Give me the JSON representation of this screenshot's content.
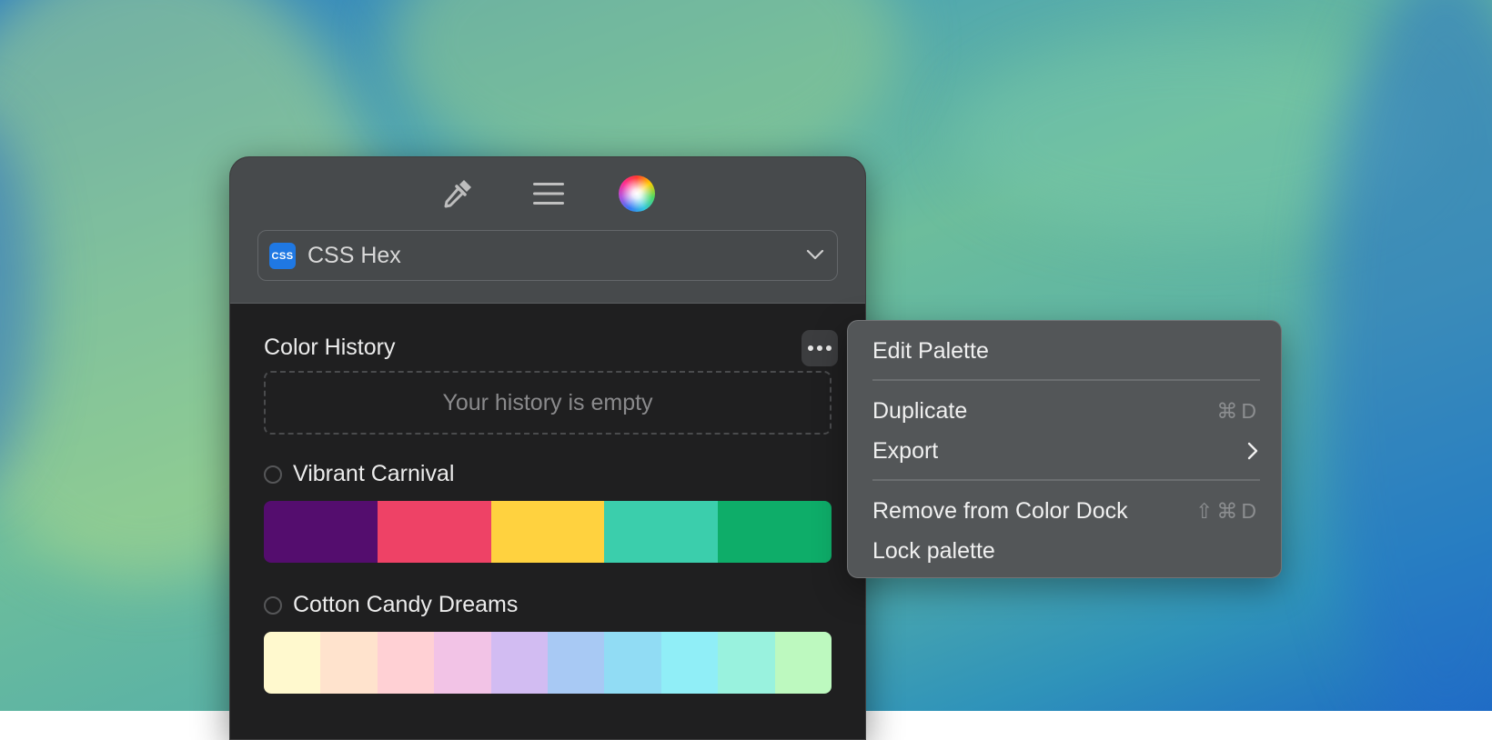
{
  "toolbar": {
    "tools": [
      "eyedropper-icon",
      "menu-icon",
      "color-wheel-icon"
    ]
  },
  "format_selector": {
    "badge": "CSS",
    "value": "CSS Hex"
  },
  "color_history": {
    "title": "Color History",
    "empty_text": "Your history is empty"
  },
  "palettes": [
    {
      "name": "Vibrant Carnival",
      "colors": [
        "#540D6E",
        "#EE4266",
        "#FFD23F",
        "#3BCEAC",
        "#0EAD69"
      ]
    },
    {
      "name": "Cotton Candy Dreams",
      "colors": [
        "#FFF9CE",
        "#FFE3CD",
        "#FFD0D4",
        "#F2C3E6",
        "#D2BCF2",
        "#A8C9F4",
        "#91DCF4",
        "#90EEF7",
        "#99F2DE",
        "#BDF9BF"
      ]
    }
  ],
  "context_menu": {
    "edit_palette": "Edit Palette",
    "duplicate": "Duplicate",
    "duplicate_shortcut": "⌘D",
    "export": "Export",
    "remove": "Remove from Color Dock",
    "remove_shortcut": "⇧⌘D",
    "lock": "Lock palette"
  }
}
